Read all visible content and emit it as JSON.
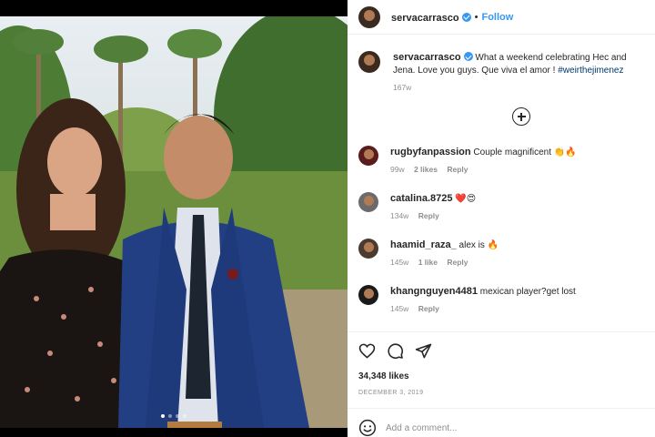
{
  "post": {
    "author": "servacarrasco",
    "follow_label": "Follow",
    "separator": "•",
    "caption": {
      "username": "servacarrasco",
      "text": "What a weekend celebrating Hec and Jena. Love you guys. Que viva el amor ! ",
      "hashtag": "#weirthejimenez",
      "age": "167w"
    },
    "comments": [
      {
        "username": "rugbyfanpassion",
        "text": "Couple magnificent",
        "emoji": "👏🔥",
        "age": "99w",
        "likes": "2 likes",
        "reply": "Reply"
      },
      {
        "username": "catalina.8725",
        "text": "",
        "emoji": "❤️😍",
        "age": "134w",
        "likes": "",
        "reply": "Reply"
      },
      {
        "username": "haamid_raza_",
        "text": "alex is",
        "emoji": "🔥",
        "age": "145w",
        "likes": "1 like",
        "reply": "Reply"
      },
      {
        "username": "khangnguyen4481",
        "text": "mexican player?get lost",
        "emoji": "",
        "age": "145w",
        "likes": "",
        "reply": "Reply"
      }
    ],
    "likes_count": "34,348 likes",
    "date": "DECEMBER 3, 2019",
    "add_comment_placeholder": "Add a comment..."
  },
  "icons": {
    "verified": "verified-badge-icon",
    "load_more": "plus-circle-icon",
    "like": "heart-outline-icon",
    "comment": "comment-bubble-icon",
    "share": "paper-plane-icon",
    "emoji": "smiley-icon"
  },
  "colors": {
    "link_blue": "#3897f0",
    "hashtag": "#00376b",
    "muted": "#8e8e8e",
    "text": "#262626"
  }
}
